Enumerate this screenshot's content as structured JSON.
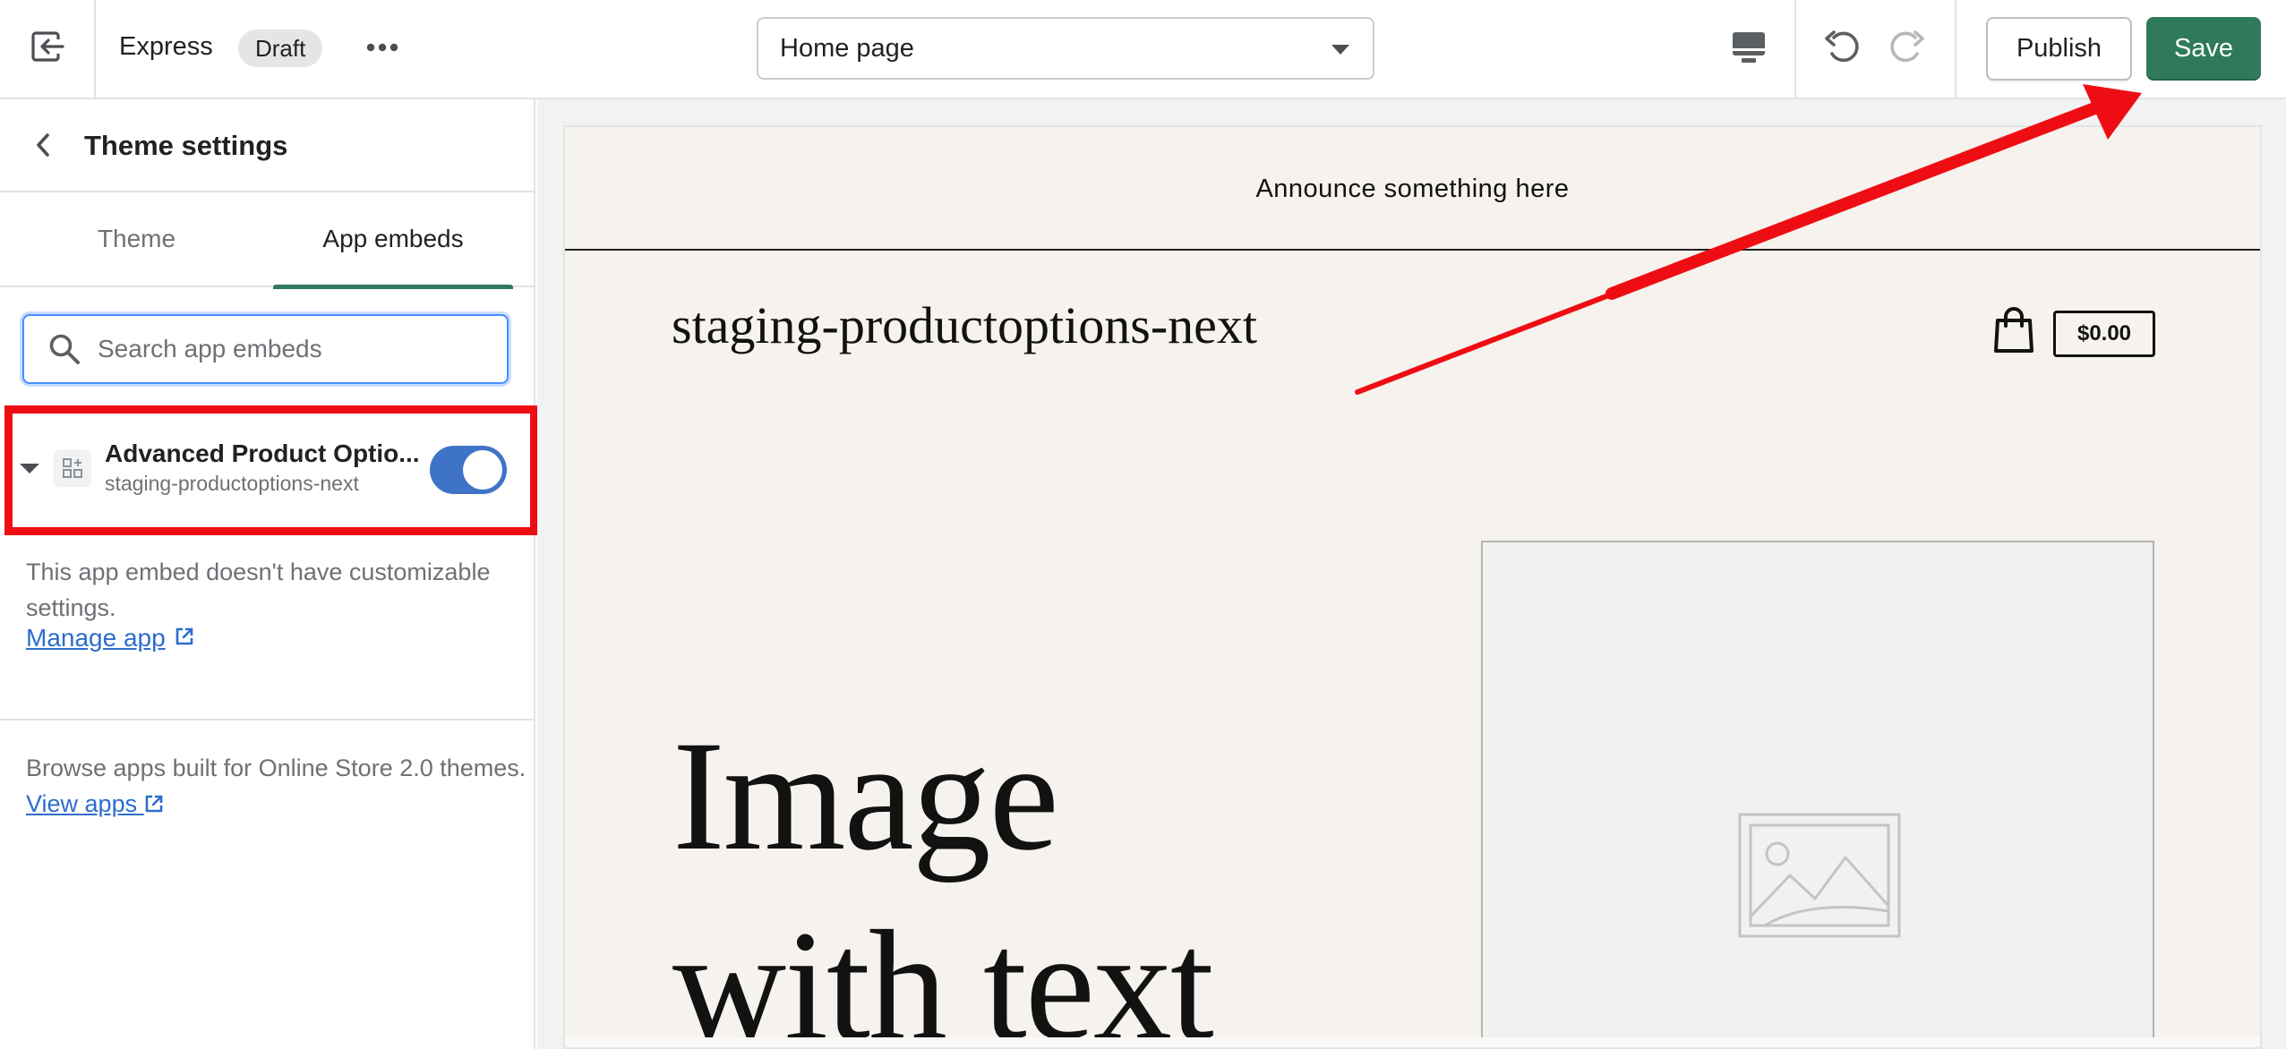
{
  "topbar": {
    "exit_icon": "exit-icon",
    "theme_name": "Express",
    "status_badge": "Draft",
    "more_icon": "more-horizontal-icon",
    "page_selector_value": "Home page",
    "device_icon": "desktop-preview-icon",
    "undo_icon": "undo-icon",
    "redo_icon": "redo-icon",
    "publish_label": "Publish",
    "save_label": "Save"
  },
  "sidebar": {
    "title": "Theme settings",
    "tabs": [
      {
        "label": "Theme",
        "active": false
      },
      {
        "label": "App embeds",
        "active": true
      }
    ],
    "search": {
      "placeholder": "Search app embeds",
      "value": ""
    },
    "embed": {
      "name": "Advanced Product Optio...",
      "source": "staging-productoptions-next",
      "enabled": true,
      "icon": "app-blocks-icon"
    },
    "embed_note": "This app embed doesn't have customizable settings.",
    "manage_link": "Manage app",
    "browse": {
      "text": "Browse apps built for Online Store 2.0 themes.",
      "link": "View apps"
    }
  },
  "preview": {
    "announcement": "Announce something here",
    "store_name": "staging-productoptions-next",
    "cart_total": "$0.00",
    "hero_line1": "Image",
    "hero_line2": "with text"
  },
  "colors": {
    "accent_green": "#2f7a5b",
    "toggle_blue": "#3f73c7",
    "link_blue": "#2c6ecb",
    "annotation_red": "#ef0d14",
    "store_background": "#f6f2ed"
  }
}
